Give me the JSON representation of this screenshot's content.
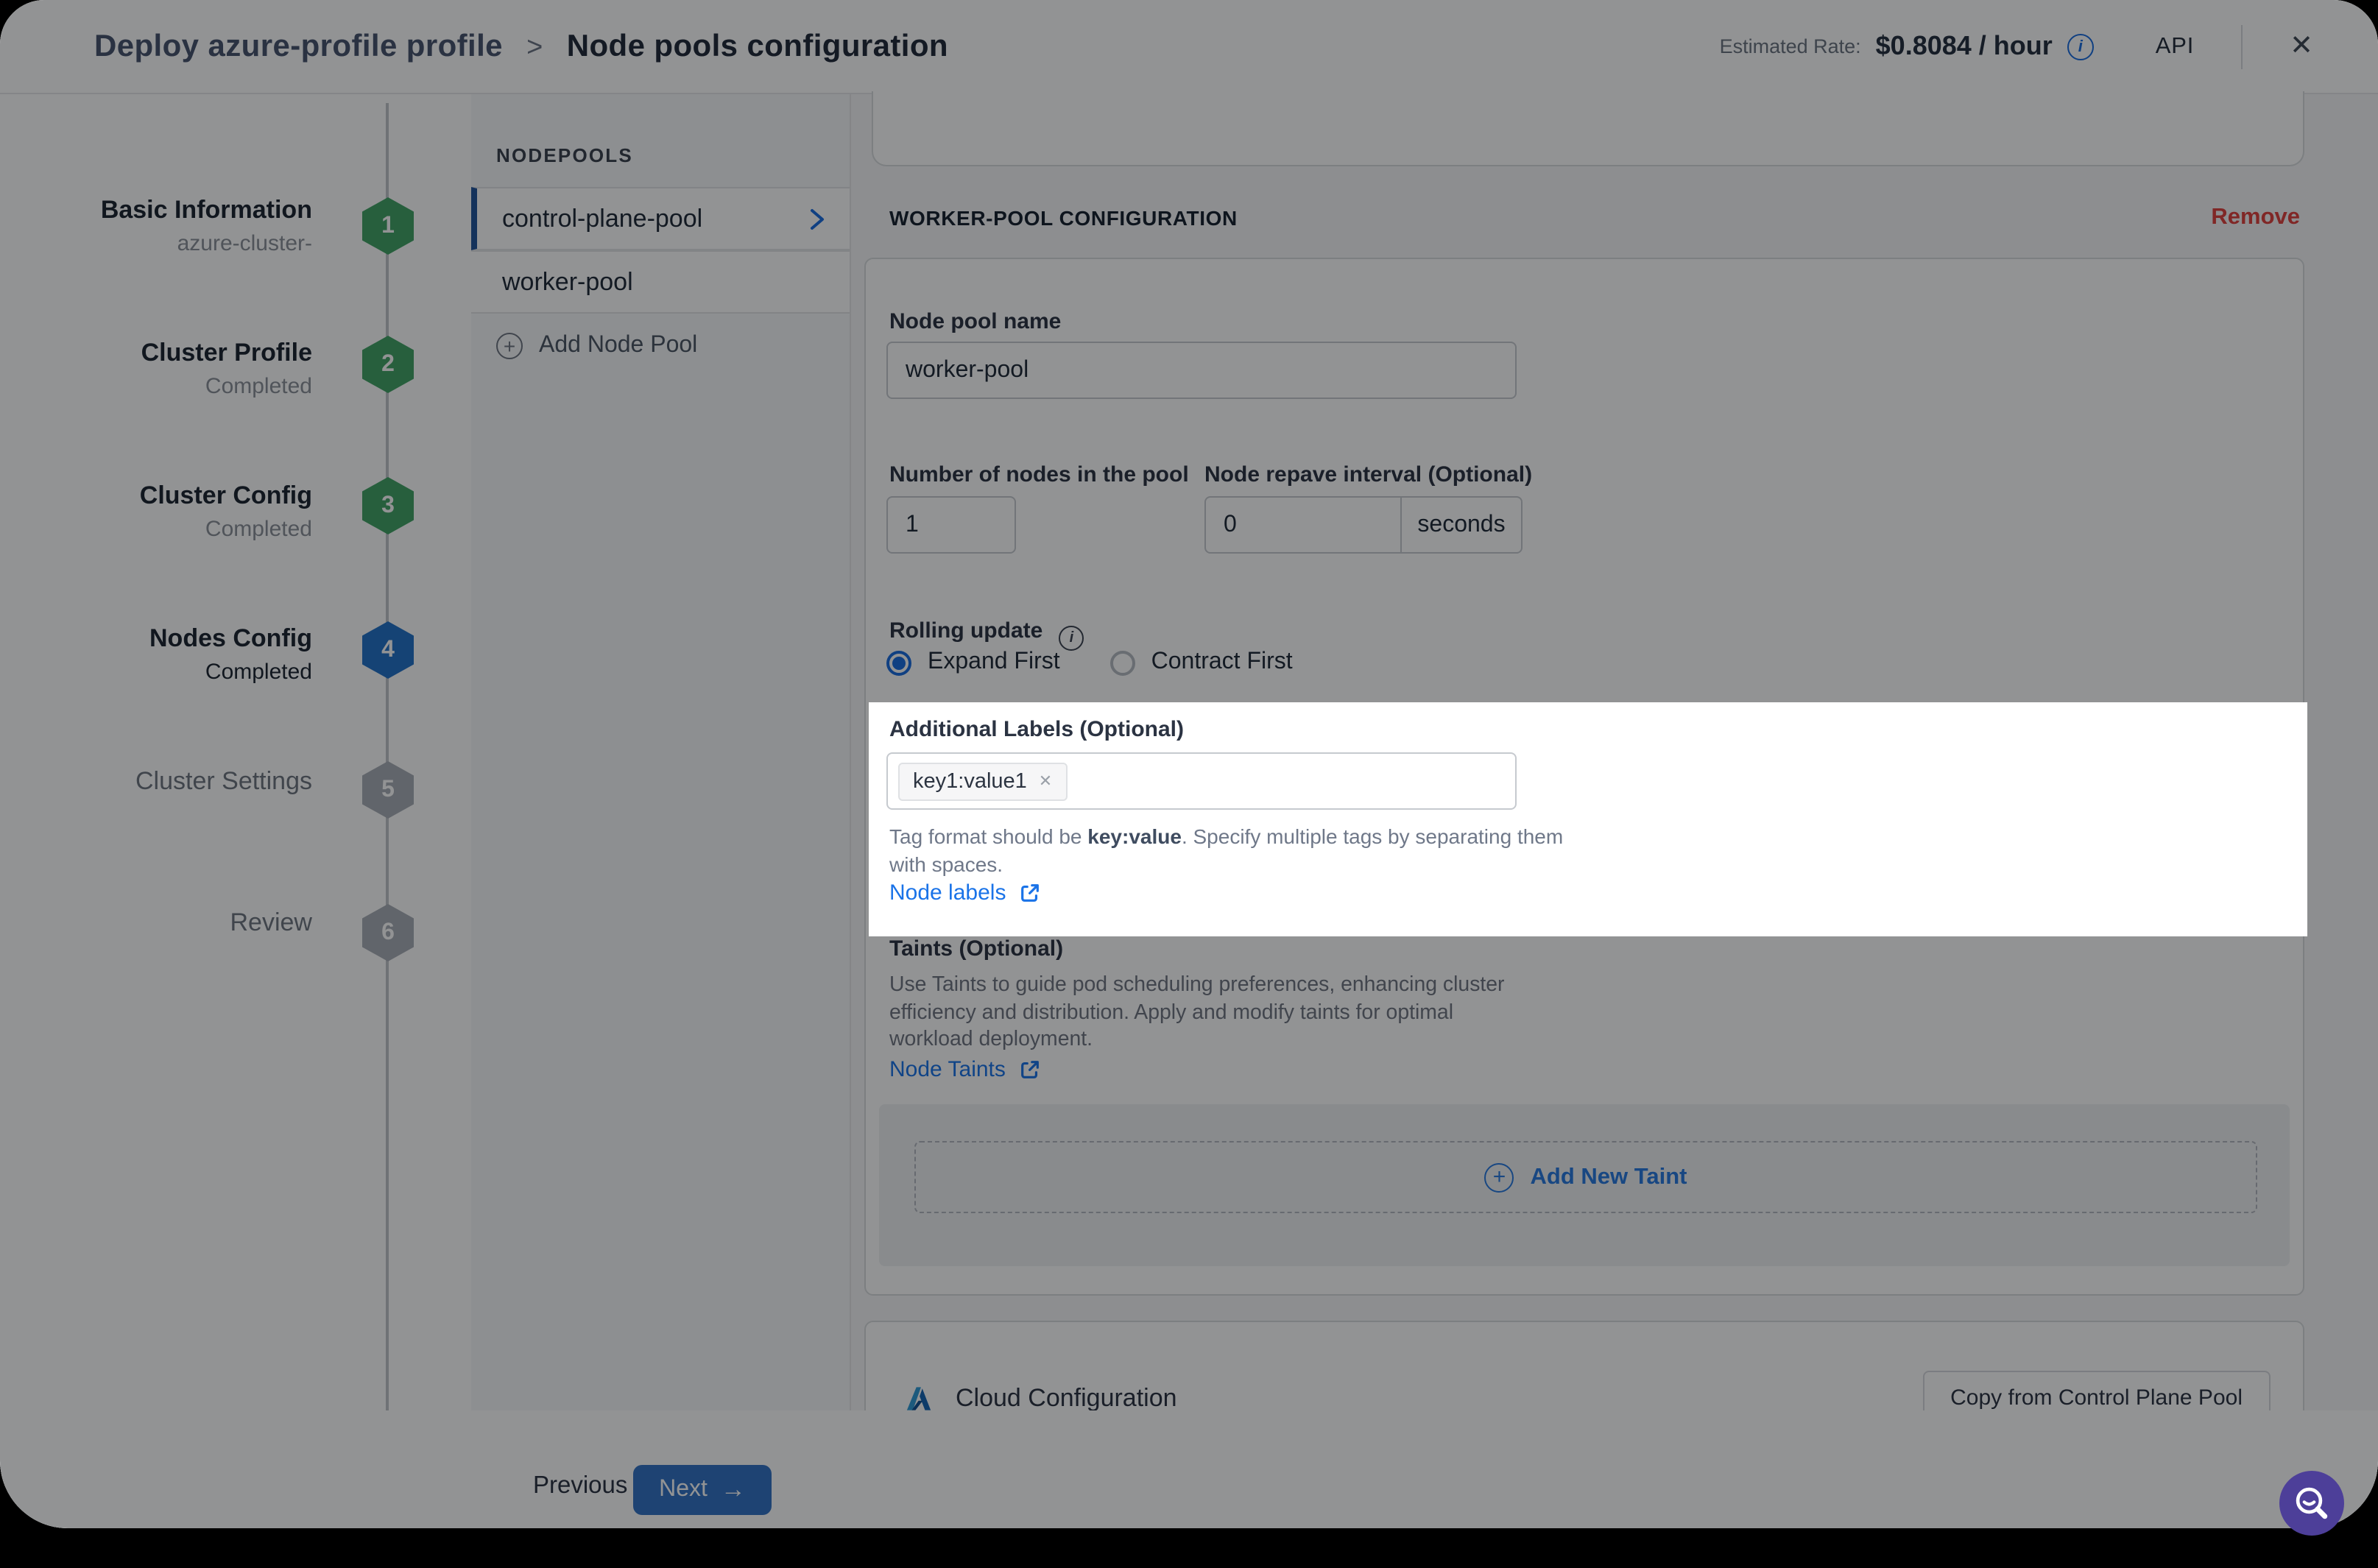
{
  "header": {
    "breadcrumb_primary": "Deploy azure-profile profile",
    "breadcrumb_separator": ">",
    "breadcrumb_secondary": "Node pools configuration",
    "estimated_rate_label": "Estimated Rate:",
    "estimated_rate_value": "$0.8084 / hour",
    "info_icon_glyph": "i",
    "api_label": "API",
    "close_icon_glyph": "✕"
  },
  "stepper": {
    "steps": [
      {
        "num": "1",
        "title": "Basic Information",
        "subtitle": "azure-cluster-",
        "state": "completed"
      },
      {
        "num": "2",
        "title": "Cluster Profile",
        "subtitle": "Completed",
        "state": "completed"
      },
      {
        "num": "3",
        "title": "Cluster Config",
        "subtitle": "Completed",
        "state": "completed"
      },
      {
        "num": "4",
        "title": "Nodes Config",
        "subtitle": "Completed",
        "state": "active"
      },
      {
        "num": "5",
        "title": "Cluster Settings",
        "subtitle": "",
        "state": "pending"
      },
      {
        "num": "6",
        "title": "Review",
        "subtitle": "",
        "state": "pending"
      }
    ]
  },
  "nodepools": {
    "header": "NODEPOOLS",
    "items": [
      {
        "label": "control-plane-pool",
        "selected": true
      },
      {
        "label": "worker-pool",
        "selected": false
      }
    ],
    "add_label": "Add Node Pool",
    "add_icon_glyph": "+"
  },
  "main": {
    "section_title": "WORKER-POOL CONFIGURATION",
    "remove_label": "Remove",
    "node_pool_name": {
      "label": "Node pool name",
      "value": "worker-pool"
    },
    "nodes_count": {
      "label": "Number of nodes in the pool",
      "value": "1"
    },
    "repave": {
      "label": "Node repave interval (Optional)",
      "value": "0",
      "unit": "seconds"
    },
    "rolling_update": {
      "label": "Rolling update",
      "info_icon_glyph": "i",
      "option1": "Expand First",
      "option2": "Contract First",
      "selected": "Expand First"
    },
    "labels_section": {
      "label": "Additional Labels (Optional)",
      "tag": "key1:value1",
      "tag_remove_glyph": "✕",
      "help_prefix": "Tag format should be ",
      "help_bold": "key:value",
      "help_suffix": ". Specify multiple tags by separating them with spaces.",
      "link": "Node labels"
    },
    "taints_section": {
      "label": "Taints (Optional)",
      "description": "Use Taints to guide pod scheduling preferences, enhancing cluster efficiency and distribution. Apply and modify taints for optimal workload deployment.",
      "link": "Node Taints",
      "add_button": "Add New Taint",
      "add_icon_glyph": "+"
    },
    "cloud_section": {
      "title": "Cloud Configuration",
      "copy_button": "Copy from Control Plane Pool"
    }
  },
  "footer": {
    "previous": "Previous",
    "next": "Next",
    "next_arrow_glyph": "→"
  },
  "colors": {
    "accent_blue": "#1a6ce0",
    "primary_button": "#3272c4",
    "step_done_green": "#42a465",
    "step_active_blue": "#2272c9",
    "step_pending_gray": "#a9aeb6",
    "remove_red": "#e0403d",
    "link_blue": "#1a73e8",
    "help_fab_purple": "#4d3f99"
  }
}
